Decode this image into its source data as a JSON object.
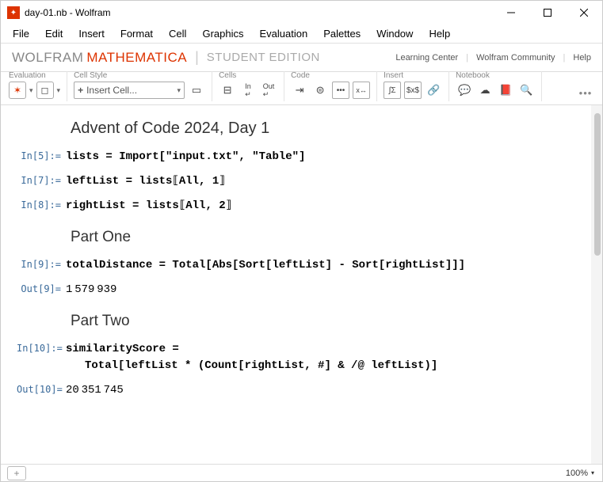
{
  "window": {
    "title": "day-01.nb - Wolfram"
  },
  "menu": [
    "File",
    "Edit",
    "Insert",
    "Format",
    "Cell",
    "Graphics",
    "Evaluation",
    "Palettes",
    "Window",
    "Help"
  ],
  "brand": {
    "wolfram": "WOLFRAM",
    "mathematica": "MATHEMATICA",
    "edition": "STUDENT EDITION",
    "links": [
      "Learning Center",
      "Wolfram Community",
      "Help"
    ]
  },
  "toolbar": {
    "groups": {
      "evaluation": "Evaluation",
      "cellstyle": "Cell Style",
      "cells": "Cells",
      "code": "Code",
      "insert": "Insert",
      "notebook": "Notebook"
    },
    "insert_cell": "Insert Cell..."
  },
  "cells": {
    "title": "Advent of Code 2024, Day 1",
    "in5_label": "In[5]:=",
    "in5": "lists = Import[\"input.txt\", \"Table\"]",
    "in7_label": "In[7]:=",
    "in7": "leftList = lists⟦All, 1⟧",
    "in8_label": "In[8]:=",
    "in8": "rightList = lists⟦All, 2⟧",
    "part1": "Part One",
    "in9_label": "In[9]:=",
    "in9": "totalDistance = Total[Abs[Sort[leftList] - Sort[rightList]]]",
    "out9_label": "Out[9]=",
    "out9": "1 579 939",
    "part2": "Part Two",
    "in10_label": "In[10]:=",
    "in10_line1": "similarityScore =",
    "in10_line2": "Total[leftList * (Count[rightList, #] & /@ leftList)]",
    "out10_label": "Out[10]=",
    "out10": "20 351 745"
  },
  "footer": {
    "zoom": "100%"
  }
}
